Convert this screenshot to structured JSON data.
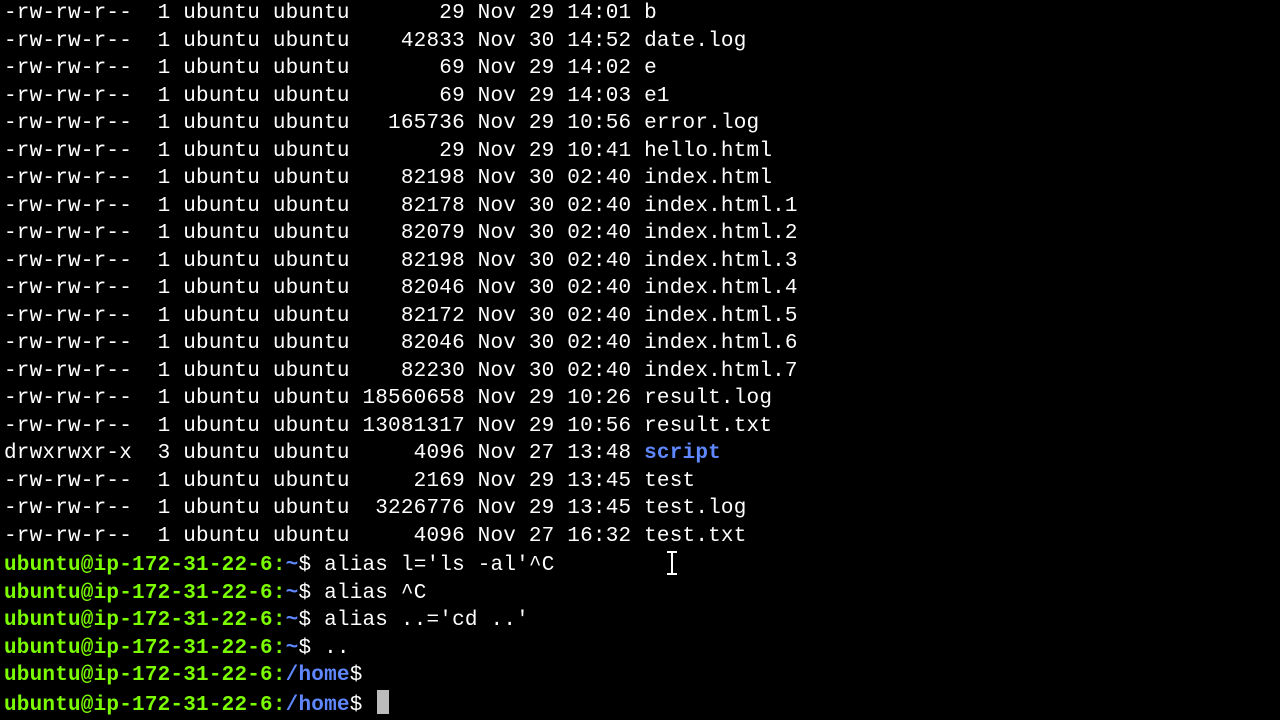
{
  "colors": {
    "fg": "#ffffff",
    "bg": "#000000",
    "dir": "#5f87ff",
    "prompt": "#7cfc00"
  },
  "listing": [
    {
      "perms": "-rw-rw-r--",
      "links": "1",
      "owner": "ubuntu",
      "group": "ubuntu",
      "size": "29",
      "month": "Nov",
      "day": "29",
      "time": "14:01",
      "name": "b",
      "is_dir": false
    },
    {
      "perms": "-rw-rw-r--",
      "links": "1",
      "owner": "ubuntu",
      "group": "ubuntu",
      "size": "42833",
      "month": "Nov",
      "day": "30",
      "time": "14:52",
      "name": "date.log",
      "is_dir": false
    },
    {
      "perms": "-rw-rw-r--",
      "links": "1",
      "owner": "ubuntu",
      "group": "ubuntu",
      "size": "69",
      "month": "Nov",
      "day": "29",
      "time": "14:02",
      "name": "e",
      "is_dir": false
    },
    {
      "perms": "-rw-rw-r--",
      "links": "1",
      "owner": "ubuntu",
      "group": "ubuntu",
      "size": "69",
      "month": "Nov",
      "day": "29",
      "time": "14:03",
      "name": "e1",
      "is_dir": false
    },
    {
      "perms": "-rw-rw-r--",
      "links": "1",
      "owner": "ubuntu",
      "group": "ubuntu",
      "size": "165736",
      "month": "Nov",
      "day": "29",
      "time": "10:56",
      "name": "error.log",
      "is_dir": false
    },
    {
      "perms": "-rw-rw-r--",
      "links": "1",
      "owner": "ubuntu",
      "group": "ubuntu",
      "size": "29",
      "month": "Nov",
      "day": "29",
      "time": "10:41",
      "name": "hello.html",
      "is_dir": false
    },
    {
      "perms": "-rw-rw-r--",
      "links": "1",
      "owner": "ubuntu",
      "group": "ubuntu",
      "size": "82198",
      "month": "Nov",
      "day": "30",
      "time": "02:40",
      "name": "index.html",
      "is_dir": false
    },
    {
      "perms": "-rw-rw-r--",
      "links": "1",
      "owner": "ubuntu",
      "group": "ubuntu",
      "size": "82178",
      "month": "Nov",
      "day": "30",
      "time": "02:40",
      "name": "index.html.1",
      "is_dir": false
    },
    {
      "perms": "-rw-rw-r--",
      "links": "1",
      "owner": "ubuntu",
      "group": "ubuntu",
      "size": "82079",
      "month": "Nov",
      "day": "30",
      "time": "02:40",
      "name": "index.html.2",
      "is_dir": false
    },
    {
      "perms": "-rw-rw-r--",
      "links": "1",
      "owner": "ubuntu",
      "group": "ubuntu",
      "size": "82198",
      "month": "Nov",
      "day": "30",
      "time": "02:40",
      "name": "index.html.3",
      "is_dir": false
    },
    {
      "perms": "-rw-rw-r--",
      "links": "1",
      "owner": "ubuntu",
      "group": "ubuntu",
      "size": "82046",
      "month": "Nov",
      "day": "30",
      "time": "02:40",
      "name": "index.html.4",
      "is_dir": false
    },
    {
      "perms": "-rw-rw-r--",
      "links": "1",
      "owner": "ubuntu",
      "group": "ubuntu",
      "size": "82172",
      "month": "Nov",
      "day": "30",
      "time": "02:40",
      "name": "index.html.5",
      "is_dir": false
    },
    {
      "perms": "-rw-rw-r--",
      "links": "1",
      "owner": "ubuntu",
      "group": "ubuntu",
      "size": "82046",
      "month": "Nov",
      "day": "30",
      "time": "02:40",
      "name": "index.html.6",
      "is_dir": false
    },
    {
      "perms": "-rw-rw-r--",
      "links": "1",
      "owner": "ubuntu",
      "group": "ubuntu",
      "size": "82230",
      "month": "Nov",
      "day": "30",
      "time": "02:40",
      "name": "index.html.7",
      "is_dir": false
    },
    {
      "perms": "-rw-rw-r--",
      "links": "1",
      "owner": "ubuntu",
      "group": "ubuntu",
      "size": "18560658",
      "month": "Nov",
      "day": "29",
      "time": "10:26",
      "name": "result.log",
      "is_dir": false
    },
    {
      "perms": "-rw-rw-r--",
      "links": "1",
      "owner": "ubuntu",
      "group": "ubuntu",
      "size": "13081317",
      "month": "Nov",
      "day": "29",
      "time": "10:56",
      "name": "result.txt",
      "is_dir": false
    },
    {
      "perms": "drwxrwxr-x",
      "links": "3",
      "owner": "ubuntu",
      "group": "ubuntu",
      "size": "4096",
      "month": "Nov",
      "day": "27",
      "time": "13:48",
      "name": "script",
      "is_dir": true
    },
    {
      "perms": "-rw-rw-r--",
      "links": "1",
      "owner": "ubuntu",
      "group": "ubuntu",
      "size": "2169",
      "month": "Nov",
      "day": "29",
      "time": "13:45",
      "name": "test",
      "is_dir": false
    },
    {
      "perms": "-rw-rw-r--",
      "links": "1",
      "owner": "ubuntu",
      "group": "ubuntu",
      "size": "3226776",
      "month": "Nov",
      "day": "29",
      "time": "13:45",
      "name": "test.log",
      "is_dir": false
    },
    {
      "perms": "-rw-rw-r--",
      "links": "1",
      "owner": "ubuntu",
      "group": "ubuntu",
      "size": "4096",
      "month": "Nov",
      "day": "27",
      "time": "16:32",
      "name": "test.txt",
      "is_dir": false
    }
  ],
  "size_width": 8,
  "prompts": [
    {
      "user": "ubuntu",
      "host": "ip-172-31-22-6",
      "path": "~",
      "command": "alias l='ls -al'^C",
      "ibeam_after": true
    },
    {
      "user": "ubuntu",
      "host": "ip-172-31-22-6",
      "path": "~",
      "command": "alias ^C"
    },
    {
      "user": "ubuntu",
      "host": "ip-172-31-22-6",
      "path": "~",
      "command": "alias ..='cd ..'"
    },
    {
      "user": "ubuntu",
      "host": "ip-172-31-22-6",
      "path": "~",
      "command": ".."
    },
    {
      "user": "ubuntu",
      "host": "ip-172-31-22-6",
      "path": "/home",
      "command": ""
    },
    {
      "user": "ubuntu",
      "host": "ip-172-31-22-6",
      "path": "/home",
      "command": "",
      "cursor": true
    }
  ]
}
